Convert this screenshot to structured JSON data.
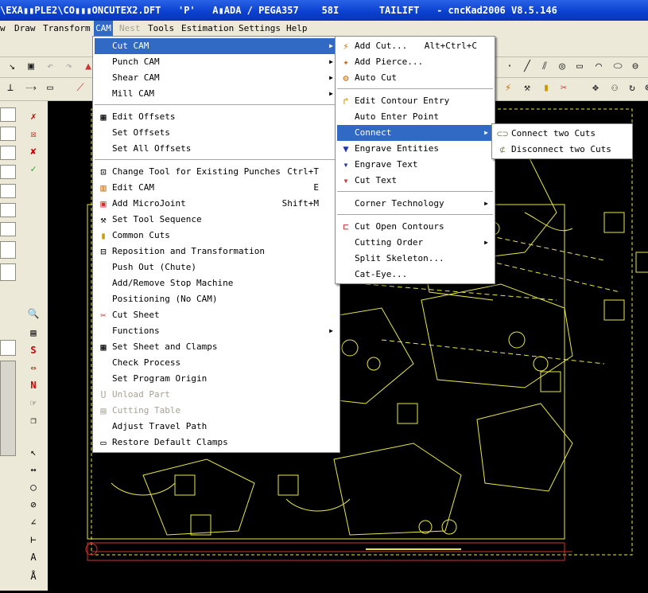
{
  "window": {
    "title": "\\EXA▮▮PLE2\\CO▮▮▮ONCUTEX2.DFT   'P'   A▮ADA / PEGA357    58I       TAILIFT   - cncKad2006 V8.5.146"
  },
  "menubar": {
    "items": [
      "w",
      "Draw",
      "Transform",
      "CAM",
      "Nest",
      "Tools",
      "Estimation",
      "Settings",
      "Help"
    ]
  },
  "cam_menu": {
    "items": [
      {
        "label": "Cut CAM",
        "icon": "none",
        "submenu": true
      },
      {
        "label": "Punch CAM",
        "icon": "none",
        "submenu": true
      },
      {
        "label": "Shear CAM",
        "icon": "none",
        "submenu": true
      },
      {
        "label": "Mill CAM",
        "icon": "none",
        "submenu": true
      },
      {
        "label": "Edit Offsets",
        "icon": "edit-offsets-icon"
      },
      {
        "label": "Set Offsets",
        "icon": "none"
      },
      {
        "label": "Set All Offsets",
        "icon": "none"
      },
      {
        "label": "Change Tool for Existing Punches",
        "shortcut": "Ctrl+T",
        "icon": "change-tool-icon"
      },
      {
        "label": "Edit CAM",
        "shortcut": "E",
        "icon": "edit-cam-icon"
      },
      {
        "label": "Add MicroJoint",
        "shortcut": "Shift+M",
        "icon": "microjoint-icon"
      },
      {
        "label": "Set Tool Sequence",
        "icon": "tool-sequence-icon"
      },
      {
        "label": "Common Cuts",
        "icon": "common-cuts-icon"
      },
      {
        "label": "Reposition and Transformation",
        "icon": "reposition-icon"
      },
      {
        "label": "Push Out (Chute)",
        "icon": "none"
      },
      {
        "label": "Add/Remove Stop Machine",
        "icon": "none"
      },
      {
        "label": "Positioning (No CAM)",
        "icon": "none"
      },
      {
        "label": "Cut Sheet",
        "icon": "cut-sheet-icon"
      },
      {
        "label": "Functions",
        "icon": "none",
        "submenu": true
      },
      {
        "label": "Set Sheet and Clamps",
        "icon": "sheet-clamps-icon"
      },
      {
        "label": "Check Process",
        "icon": "none"
      },
      {
        "label": "Set Program Origin",
        "icon": "none"
      },
      {
        "label": "Unload Part",
        "icon": "unload-part-icon",
        "disabled": true
      },
      {
        "label": "Cutting Table",
        "icon": "cutting-table-icon",
        "disabled": true
      },
      {
        "label": "Adjust Travel Path",
        "icon": "none"
      },
      {
        "label": "Restore Default Clamps",
        "icon": "restore-clamps-icon"
      }
    ]
  },
  "cutcam_menu": {
    "items": [
      {
        "label": "Add Cut...",
        "shortcut": "Alt+Ctrl+C",
        "icon": "add-cut-icon"
      },
      {
        "label": "Add Pierce...",
        "icon": "add-pierce-icon"
      },
      {
        "label": "Auto Cut",
        "icon": "auto-cut-icon"
      },
      {
        "label": "Edit Contour Entry",
        "icon": "contour-entry-icon"
      },
      {
        "label": "Auto Enter Point",
        "icon": "none"
      },
      {
        "label": "Connect",
        "icon": "none",
        "submenu": true
      },
      {
        "label": "Engrave Entities",
        "icon": "engrave-entities-icon"
      },
      {
        "label": "Engrave Text",
        "icon": "engrave-text-icon"
      },
      {
        "label": "Cut Text",
        "icon": "cut-text-icon"
      },
      {
        "label": "Corner Technology",
        "icon": "none",
        "submenu": true
      },
      {
        "label": "Cut Open Contours",
        "icon": "open-contours-icon"
      },
      {
        "label": "Cutting Order",
        "icon": "none",
        "submenu": true
      },
      {
        "label": "Split Skeleton...",
        "icon": "none"
      },
      {
        "label": "Cat-Eye...",
        "icon": "none"
      }
    ]
  },
  "connect_menu": {
    "items": [
      {
        "label": "Connect two Cuts",
        "icon": "connect-cuts-icon"
      },
      {
        "label": "Disconnect two Cuts",
        "icon": "disconnect-cuts-icon"
      }
    ]
  },
  "colors": {
    "selection": "#316ac5",
    "drawing": "#e8e84a",
    "menu_bg": "#ffffff",
    "chrome": "#ece9d8"
  }
}
